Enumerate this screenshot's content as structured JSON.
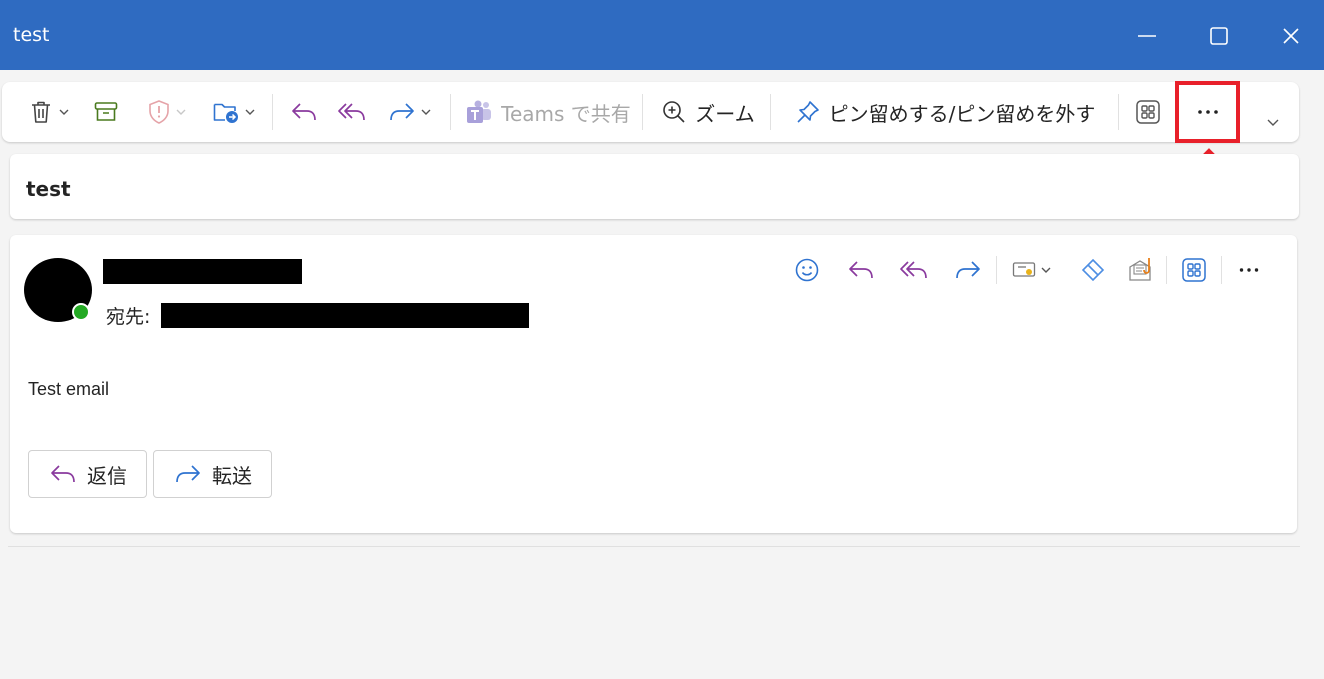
{
  "window": {
    "title": "test",
    "minimize_icon": "minimize-icon",
    "maximize_icon": "maximize-icon",
    "close_icon": "close-icon"
  },
  "toolbar": {
    "delete_icon": "trash-icon",
    "archive_icon": "archive-icon",
    "report_icon": "shield-icon",
    "move_icon": "folder-move-icon",
    "reply_icon": "reply-icon",
    "reply_all_icon": "reply-all-icon",
    "forward_icon": "forward-icon",
    "teams_label": "Teams で共有",
    "zoom_label": "ズーム",
    "pin_label": "ピン留めする/ピン留めを外す",
    "apps_icon": "apps-icon",
    "more_icon": "more-icon",
    "expand_icon": "chevron-down-icon"
  },
  "subject": "test",
  "message": {
    "to_label": "宛先:",
    "body": "Test email",
    "reply_button": "返信",
    "forward_button": "転送"
  },
  "colors": {
    "titlebar": "#2f6bc1",
    "reply_purple": "#8a3a9e",
    "forward_blue": "#2f73d0",
    "highlight_red": "#e8202a"
  }
}
